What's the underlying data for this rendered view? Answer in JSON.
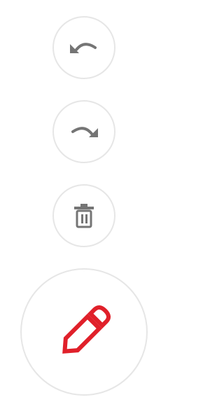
{
  "toolbar": {
    "buttons": [
      {
        "id": "undo",
        "icon": "undo-icon",
        "color": "#757575"
      },
      {
        "id": "redo",
        "icon": "redo-icon",
        "color": "#757575"
      },
      {
        "id": "delete",
        "icon": "trash-icon",
        "color": "#757575"
      },
      {
        "id": "draw",
        "icon": "pencil-icon",
        "color": "#e0202a"
      }
    ],
    "border_color": "#e6e6e6"
  }
}
